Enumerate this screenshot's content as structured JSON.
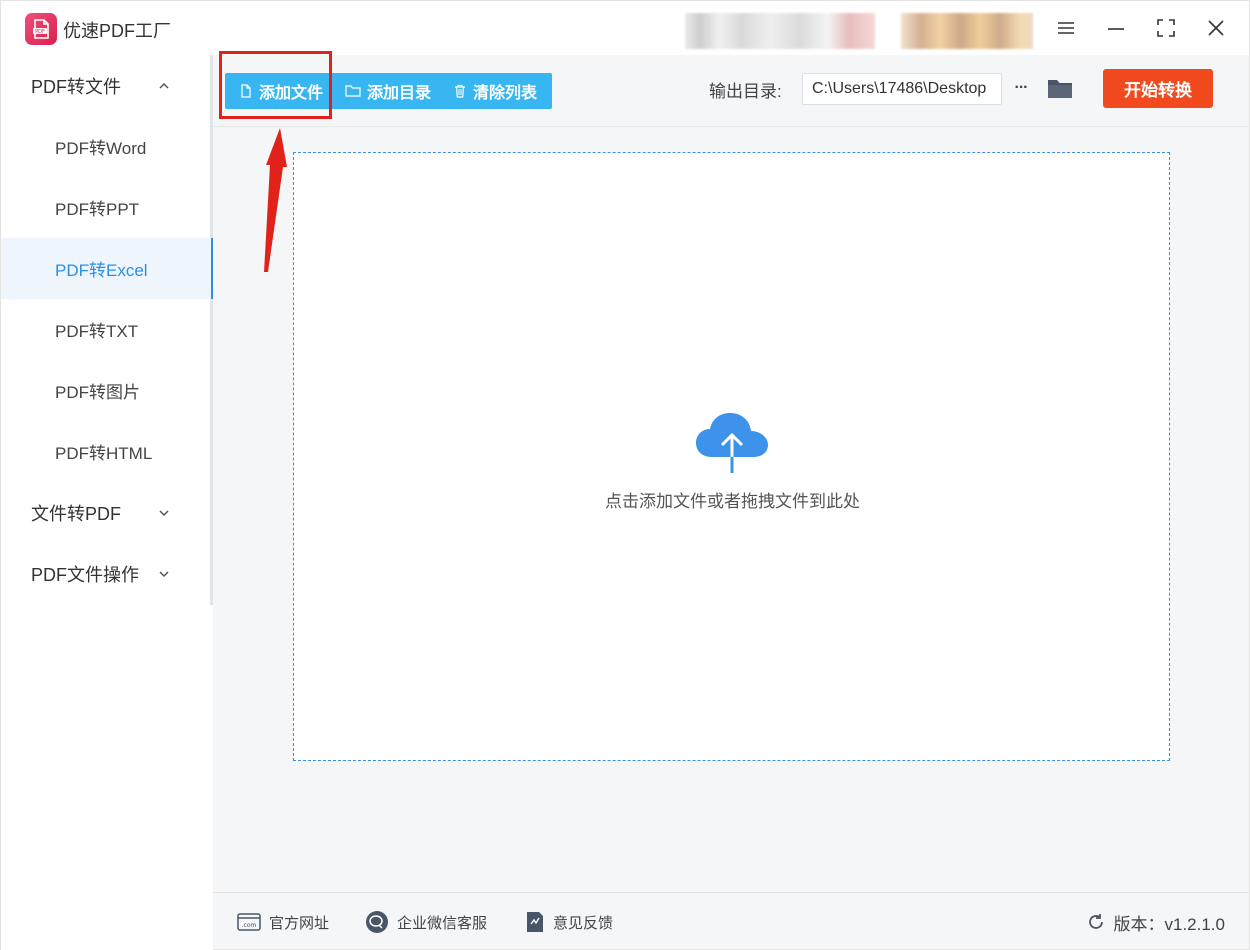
{
  "app": {
    "title": "优速PDF工厂",
    "logo_text": "PDF"
  },
  "sidebar": {
    "groups": [
      {
        "label": "PDF转文件",
        "expanded": true
      },
      {
        "label": "文件转PDF",
        "expanded": false
      },
      {
        "label": "PDF文件操作",
        "expanded": false
      }
    ],
    "items": [
      {
        "label": "PDF转Word",
        "active": false
      },
      {
        "label": "PDF转PPT",
        "active": false
      },
      {
        "label": "PDF转Excel",
        "active": true
      },
      {
        "label": "PDF转TXT",
        "active": false
      },
      {
        "label": "PDF转图片",
        "active": false
      },
      {
        "label": "PDF转HTML",
        "active": false
      }
    ]
  },
  "toolbar": {
    "add_file": "添加文件",
    "add_folder": "添加目录",
    "clear_list": "清除列表",
    "output_label": "输出目录:",
    "output_path": "C:\\Users\\17486\\Desktop",
    "more": "···",
    "start": "开始转换"
  },
  "dropzone": {
    "hint": "点击添加文件或者拖拽文件到此处"
  },
  "footer": {
    "website": "官方网址",
    "wechat": "企业微信客服",
    "feedback": "意见反馈",
    "version": "版本：v1.2.1.0"
  },
  "colors": {
    "accent": "#38b6f2",
    "start": "#f04a1e",
    "highlight": "#e0221b",
    "active_text": "#2a8fe4"
  }
}
